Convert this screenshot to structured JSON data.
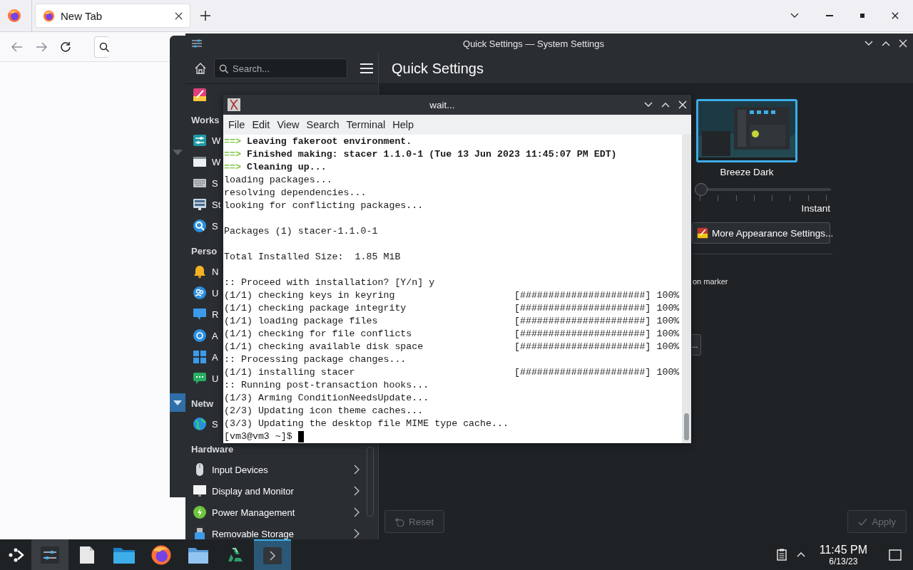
{
  "browser": {
    "tab": {
      "title": "New Tab",
      "selected": true
    }
  },
  "settings": {
    "title": "Quick Settings — System Settings",
    "search": {
      "placeholder": "Search..."
    },
    "heading": "Quick Settings",
    "sidebar": [
      {
        "kind": "item"
      },
      {
        "kind": "heading",
        "label": "Works"
      },
      {
        "kind": "item",
        "label": "W",
        "expandable": false
      },
      {
        "kind": "item",
        "label": "W",
        "expandable": false
      },
      {
        "kind": "item",
        "label": "S",
        "expandable": false
      },
      {
        "kind": "item",
        "label": "St",
        "expandable": false
      },
      {
        "kind": "item",
        "label": "S",
        "expandable": false
      },
      {
        "kind": "heading",
        "label": "Perso"
      },
      {
        "kind": "item",
        "label": "N",
        "expandable": false
      },
      {
        "kind": "item",
        "label": "U",
        "expandable": false
      },
      {
        "kind": "item",
        "label": "R",
        "expandable": false
      },
      {
        "kind": "item",
        "label": "A",
        "expandable": false
      },
      {
        "kind": "item",
        "label": "A",
        "expandable": false
      },
      {
        "kind": "item",
        "label": "U",
        "expandable": false
      },
      {
        "kind": "heading",
        "label": "Netw"
      },
      {
        "kind": "item",
        "label": "S",
        "expandable": false
      },
      {
        "kind": "heading",
        "label": "Hardware"
      },
      {
        "kind": "item",
        "label": "Input Devices",
        "expandable": true
      },
      {
        "kind": "item",
        "label": "Display and Monitor",
        "expandable": true
      },
      {
        "kind": "item",
        "label": "Power Management",
        "expandable": true
      },
      {
        "kind": "item",
        "label": "Removable Storage",
        "expandable": true
      }
    ],
    "theme": {
      "label": "Breeze Dark",
      "selected": true
    },
    "animation_slider": {
      "level": 0,
      "end_label": "Instant"
    },
    "more_button": "More Appearance Settings...",
    "partial_label": "on marker",
    "partial_button": "...",
    "reset_button": {
      "label": "Reset",
      "disabled": true
    },
    "apply_button": {
      "label": "Apply",
      "disabled": true
    }
  },
  "terminal": {
    "title": "wait...",
    "menu": [
      "File",
      "Edit",
      "View",
      "Search",
      "Terminal",
      "Help"
    ],
    "lines": [
      {
        "kind": "step",
        "prefix": "==>",
        "text": "Leaving fakeroot environment."
      },
      {
        "kind": "step",
        "prefix": "==>",
        "text": "Finished making: stacer 1.1.0-1 (Tue 13 Jun 2023 11:45:07 PM EDT)"
      },
      {
        "kind": "step",
        "prefix": "==>",
        "text": "Cleaning up..."
      },
      {
        "kind": "plain",
        "text": "loading packages..."
      },
      {
        "kind": "plain",
        "text": "resolving dependencies..."
      },
      {
        "kind": "plain",
        "text": "looking for conflicting packages..."
      },
      {
        "kind": "blank"
      },
      {
        "kind": "plain",
        "text": "Packages (1) stacer-1.1.0-1"
      },
      {
        "kind": "blank"
      },
      {
        "kind": "plain",
        "text": "Total Installed Size:  1.85 MiB"
      },
      {
        "kind": "blank"
      },
      {
        "kind": "plain",
        "text": ":: Proceed with installation? [Y/n] y"
      },
      {
        "kind": "progress",
        "text": "(1/1) checking keys in keyring",
        "bar": "[######################]",
        "percent": "100%"
      },
      {
        "kind": "progress",
        "text": "(1/1) checking package integrity",
        "bar": "[######################]",
        "percent": "100%"
      },
      {
        "kind": "progress",
        "text": "(1/1) loading package files",
        "bar": "[######################]",
        "percent": "100%"
      },
      {
        "kind": "progress",
        "text": "(1/1) checking for file conflicts",
        "bar": "[######################]",
        "percent": "100%"
      },
      {
        "kind": "progress",
        "text": "(1/1) checking available disk space",
        "bar": "[######################]",
        "percent": "100%"
      },
      {
        "kind": "plain",
        "text": ":: Processing package changes..."
      },
      {
        "kind": "progress",
        "text": "(1/1) installing stacer",
        "bar": "[######################]",
        "percent": "100%"
      },
      {
        "kind": "plain",
        "text": ":: Running post-transaction hooks..."
      },
      {
        "kind": "plain",
        "text": "(1/3) Arming ConditionNeedsUpdate..."
      },
      {
        "kind": "plain",
        "text": "(2/3) Updating icon theme caches..."
      },
      {
        "kind": "plain",
        "text": "(3/3) Updating the desktop file MIME type cache..."
      },
      {
        "kind": "prompt",
        "text": "[vm3@vm3 ~]$"
      }
    ]
  },
  "taskbar": {
    "tasks": [
      {
        "open": true,
        "selected": false
      },
      {
        "open": false,
        "selected": false
      },
      {
        "open": false,
        "selected": false
      },
      {
        "open": false,
        "selected": false
      },
      {
        "open": false,
        "selected": false
      },
      {
        "open": false,
        "selected": false
      },
      {
        "open": false,
        "selected": true
      }
    ],
    "time": "11:45 PM",
    "date": "6/13/23"
  }
}
